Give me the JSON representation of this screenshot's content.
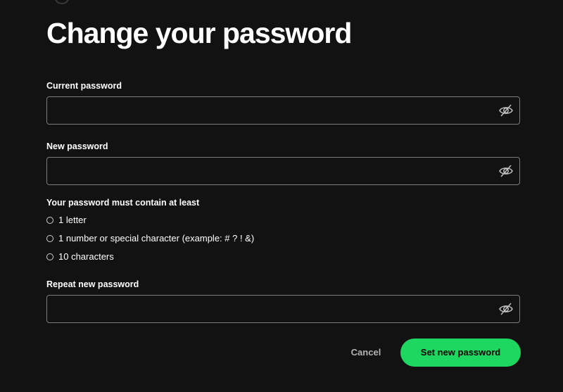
{
  "page": {
    "title": "Change your password"
  },
  "fields": {
    "current": {
      "label": "Current password",
      "value": "",
      "toggle_icon": "eye-slash-icon"
    },
    "new": {
      "label": "New password",
      "value": "",
      "toggle_icon": "eye-slash-icon"
    },
    "repeat": {
      "label": "Repeat new password",
      "value": "",
      "toggle_icon": "eye-slash-icon"
    }
  },
  "requirements": {
    "title": "Your password must contain at least",
    "items": [
      {
        "text": "1 letter",
        "met": false
      },
      {
        "text": "1 number or special character (example: # ? ! &)",
        "met": false
      },
      {
        "text": "10 characters",
        "met": false
      }
    ]
  },
  "actions": {
    "cancel_label": "Cancel",
    "submit_label": "Set new password"
  },
  "colors": {
    "background": "#121212",
    "accent": "#1ed760",
    "border": "#7c7c7c",
    "muted_text": "#b3b3b3"
  }
}
